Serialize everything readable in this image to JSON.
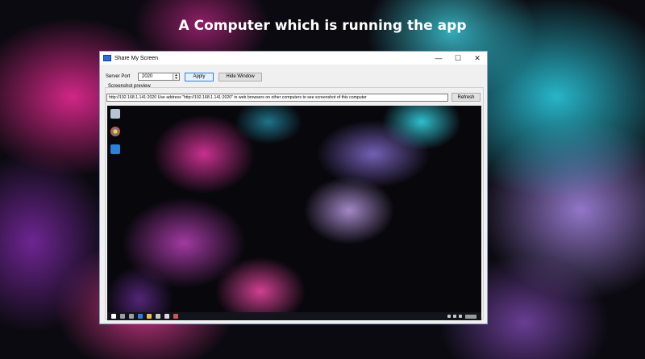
{
  "headline": "A Computer which is running the app",
  "window": {
    "title": "Share My Screen",
    "minimize_glyph": "—",
    "maximize_glyph": "☐",
    "close_glyph": "✕"
  },
  "controls": {
    "port_label": "Server Port",
    "port_value": "2020",
    "apply_label": "Apply",
    "hide_label": "Hide Window"
  },
  "preview": {
    "group_label": "Screenshot preview",
    "address_text": "http://192.168.1.141:2020   Use address \"http://192.168.1.141:2020\" in web browsers on other computers to see screenshot of this computer",
    "refresh_label": "Refresh"
  },
  "icons": {
    "desktop": [
      "recycle-bin-icon",
      "chrome-icon",
      "edge-icon"
    ],
    "taskbar": [
      "start-icon",
      "search-icon",
      "task-view-icon",
      "edge-icon",
      "explorer-icon",
      "store-icon",
      "camera-icon",
      "app-icon"
    ]
  },
  "colors": {
    "accent": "#3c7fd6",
    "window_bg": "#f0f0f0"
  }
}
